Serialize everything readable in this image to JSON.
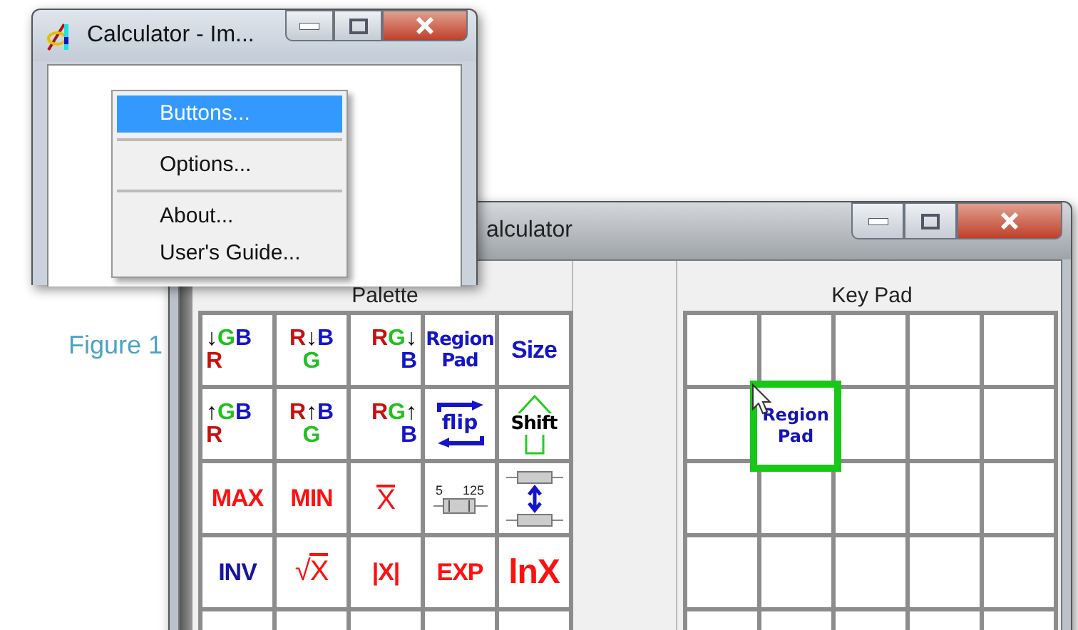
{
  "figure_caption": "Figure 1",
  "back_window": {
    "title": "alculator",
    "palette": {
      "title": "Palette",
      "keys": [
        {
          "kind": "stack-left",
          "lines": [
            [
              {
                "text": "↓",
                "color": "#000000"
              },
              {
                "text": "G",
                "color": "#22c022"
              },
              {
                "text": "B",
                "color": "#1515c8"
              }
            ],
            [
              {
                "text": "R",
                "color": "#c81010"
              }
            ]
          ]
        },
        {
          "kind": "stack-center",
          "lines": [
            [
              {
                "text": "R",
                "color": "#c81010"
              },
              {
                "text": "↓",
                "color": "#000000"
              },
              {
                "text": "B",
                "color": "#1515c8"
              }
            ],
            [
              {
                "text": "G",
                "color": "#22c022"
              }
            ]
          ]
        },
        {
          "kind": "stack-right",
          "lines": [
            [
              {
                "text": "R",
                "color": "#c81010"
              },
              {
                "text": "G",
                "color": "#22c022"
              },
              {
                "text": "↓",
                "color": "#000000"
              }
            ],
            [
              {
                "text": "B",
                "color": "#1515c8"
              }
            ]
          ]
        },
        {
          "kind": "stack-center",
          "lines": [
            [
              {
                "text": "Region",
                "color": "#1515c8"
              }
            ],
            [
              {
                "text": "Pad",
                "color": "#1515c8"
              }
            ]
          ]
        },
        {
          "kind": "word",
          "label": "Size",
          "color": "#1515c8"
        },
        {
          "kind": "stack-left",
          "lines": [
            [
              {
                "text": "↑",
                "color": "#000000"
              },
              {
                "text": "G",
                "color": "#22c022"
              },
              {
                "text": "B",
                "color": "#1515c8"
              }
            ],
            [
              {
                "text": "R",
                "color": "#c81010"
              }
            ]
          ]
        },
        {
          "kind": "stack-center",
          "lines": [
            [
              {
                "text": "R",
                "color": "#c81010"
              },
              {
                "text": "↑",
                "color": "#000000"
              },
              {
                "text": "B",
                "color": "#1515c8"
              }
            ],
            [
              {
                "text": "G",
                "color": "#22c022"
              }
            ]
          ]
        },
        {
          "kind": "stack-right",
          "lines": [
            [
              {
                "text": "R",
                "color": "#c81010"
              },
              {
                "text": "G",
                "color": "#22c022"
              },
              {
                "text": "↑",
                "color": "#000000"
              }
            ],
            [
              {
                "text": "B",
                "color": "#1515c8"
              }
            ]
          ]
        },
        {
          "kind": "flip",
          "label": "flip",
          "color": "#1515c8"
        },
        {
          "kind": "shift",
          "label": "Shift",
          "color": "#000000"
        },
        {
          "kind": "word",
          "label": "MAX",
          "color": "#ff1010"
        },
        {
          "kind": "word",
          "label": "MIN",
          "color": "#ff1010"
        },
        {
          "kind": "mean",
          "label": "X",
          "color": "#ff1010"
        },
        {
          "kind": "slider",
          "low": "5",
          "high": "125"
        },
        {
          "kind": "double-slider"
        },
        {
          "kind": "word",
          "label": "INV",
          "color": "#1515a0"
        },
        {
          "kind": "root",
          "sign": "√",
          "label": "X",
          "color": "#ff1010"
        },
        {
          "kind": "word",
          "label": "|X|",
          "color": "#ff1010"
        },
        {
          "kind": "word",
          "label": "EXP",
          "color": "#ff1010"
        },
        {
          "kind": "big",
          "label": "lnX",
          "color": "#ff1010"
        },
        {
          "kind": "blank"
        },
        {
          "kind": "blank"
        },
        {
          "kind": "blank"
        },
        {
          "kind": "blank"
        },
        {
          "kind": "blank"
        }
      ]
    },
    "keypad": {
      "title": "Key Pad",
      "cells": [
        {
          "kind": "empty"
        },
        {
          "kind": "empty"
        },
        {
          "kind": "empty"
        },
        {
          "kind": "empty"
        },
        {
          "kind": "empty"
        },
        {
          "kind": "empty"
        },
        {
          "kind": "key",
          "lines": [
            "Region",
            "Pad"
          ],
          "selected": true
        },
        {
          "kind": "empty"
        },
        {
          "kind": "empty"
        },
        {
          "kind": "empty"
        },
        {
          "kind": "empty"
        },
        {
          "kind": "empty"
        },
        {
          "kind": "empty"
        },
        {
          "kind": "empty"
        },
        {
          "kind": "empty"
        },
        {
          "kind": "empty"
        },
        {
          "kind": "empty"
        },
        {
          "kind": "empty"
        },
        {
          "kind": "empty"
        },
        {
          "kind": "empty"
        },
        {
          "kind": "empty"
        },
        {
          "kind": "empty"
        },
        {
          "kind": "empty"
        },
        {
          "kind": "empty"
        },
        {
          "kind": "empty"
        }
      ]
    }
  },
  "front_window": {
    "title": "Calculator - Im...",
    "menu": [
      {
        "kind": "item",
        "label": "Buttons...",
        "selected": true
      },
      {
        "kind": "separator"
      },
      {
        "kind": "item",
        "label": "Options...",
        "selected": false
      },
      {
        "kind": "separator"
      },
      {
        "kind": "item",
        "label": "About...",
        "selected": false
      },
      {
        "kind": "item",
        "label": "User's Guide...",
        "selected": false
      }
    ]
  }
}
